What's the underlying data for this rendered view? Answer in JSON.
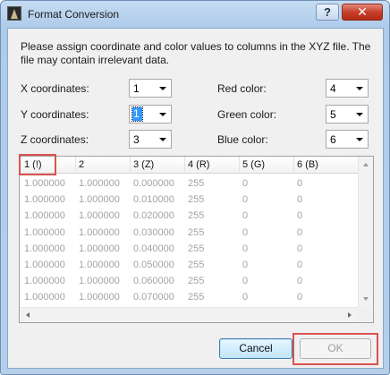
{
  "window": {
    "title": "Format Conversion",
    "help_label": "?",
    "close_label": "✕"
  },
  "intro_text": "Please assign coordinate and color values to columns in the XYZ file. The file may contain irrelevant data.",
  "fields": {
    "x": {
      "label": "X coordinates:",
      "value": "1"
    },
    "y": {
      "label": "Y coordinates:",
      "value": "1"
    },
    "z": {
      "label": "Z coordinates:",
      "value": "3"
    },
    "red": {
      "label": "Red color:",
      "value": "4"
    },
    "green": {
      "label": "Green color:",
      "value": "5"
    },
    "blue": {
      "label": "Blue color:",
      "value": "6"
    }
  },
  "table": {
    "headers": [
      "1 (!)",
      "2",
      "3 (Z)",
      "4 (R)",
      "5 (G)",
      "6 (B)"
    ],
    "rows": [
      [
        "1.000000",
        "1.000000",
        "0.000000",
        "255",
        "0",
        "0"
      ],
      [
        "1.000000",
        "1.000000",
        "0.010000",
        "255",
        "0",
        "0"
      ],
      [
        "1.000000",
        "1.000000",
        "0.020000",
        "255",
        "0",
        "0"
      ],
      [
        "1.000000",
        "1.000000",
        "0.030000",
        "255",
        "0",
        "0"
      ],
      [
        "1.000000",
        "1.000000",
        "0.040000",
        "255",
        "0",
        "0"
      ],
      [
        "1.000000",
        "1.000000",
        "0.050000",
        "255",
        "0",
        "0"
      ],
      [
        "1.000000",
        "1.000000",
        "0.060000",
        "255",
        "0",
        "0"
      ],
      [
        "1.000000",
        "1.000000",
        "0.070000",
        "255",
        "0",
        "0"
      ]
    ]
  },
  "buttons": {
    "cancel": "Cancel",
    "ok": "OK"
  },
  "colors": {
    "annotation": "#d9534f",
    "selection": "#3399ff"
  }
}
